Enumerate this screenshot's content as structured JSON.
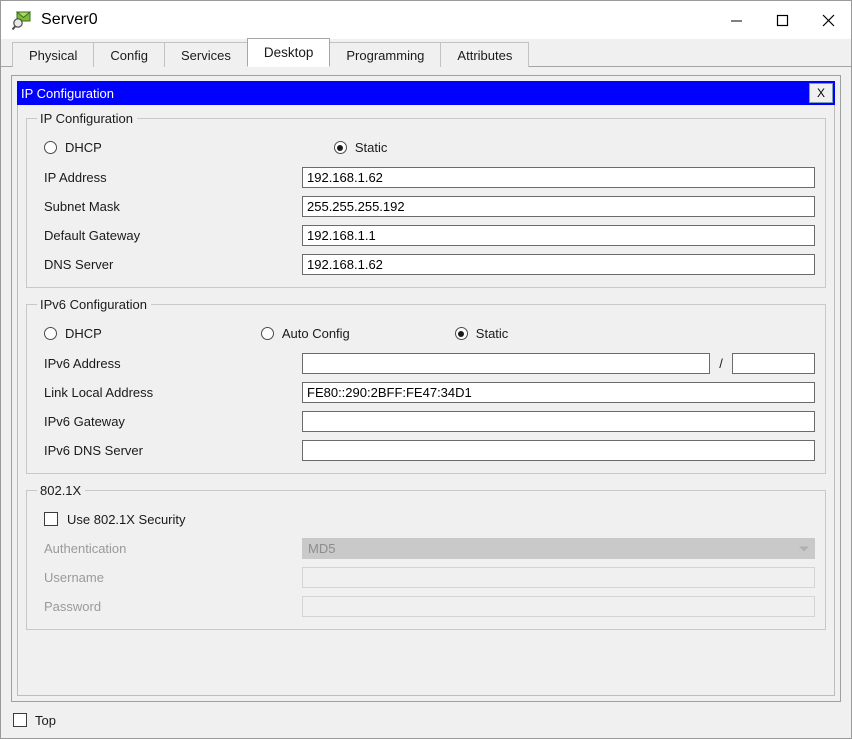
{
  "window": {
    "title": "Server0",
    "icon": "server-device-icon",
    "controls": {
      "minimize": "minimize-icon",
      "maximize": "maximize-icon",
      "close": "close-icon"
    }
  },
  "tabs": [
    {
      "label": "Physical",
      "active": false
    },
    {
      "label": "Config",
      "active": false
    },
    {
      "label": "Services",
      "active": false
    },
    {
      "label": "Desktop",
      "active": true
    },
    {
      "label": "Programming",
      "active": false
    },
    {
      "label": "Attributes",
      "active": false
    }
  ],
  "dialog": {
    "title": "IP Configuration",
    "close_label": "X",
    "header_color": "#0000ff",
    "header_text_color": "#ffffff"
  },
  "ipv4": {
    "legend": "IP Configuration",
    "mode_dhcp": {
      "label": "DHCP",
      "selected": false
    },
    "mode_static": {
      "label": "Static",
      "selected": true
    },
    "fields": [
      {
        "label": "IP Address",
        "value": "192.168.1.62"
      },
      {
        "label": "Subnet Mask",
        "value": "255.255.255.192"
      },
      {
        "label": "Default Gateway",
        "value": "192.168.1.1"
      },
      {
        "label": "DNS Server",
        "value": "192.168.1.62"
      }
    ]
  },
  "ipv6": {
    "legend": "IPv6 Configuration",
    "mode_dhcp": {
      "label": "DHCP",
      "selected": false
    },
    "mode_auto": {
      "label": "Auto Config",
      "selected": false
    },
    "mode_static": {
      "label": "Static",
      "selected": true
    },
    "address": {
      "label": "IPv6 Address",
      "value": "",
      "prefix_separator": "/",
      "prefix_value": ""
    },
    "link_local": {
      "label": "Link Local Address",
      "value": "FE80::290:2BFF:FE47:34D1"
    },
    "gateway": {
      "label": "IPv6 Gateway",
      "value": ""
    },
    "dns": {
      "label": "IPv6 DNS Server",
      "value": ""
    }
  },
  "dot1x": {
    "legend": "802.1X",
    "use_security": {
      "label": "Use 802.1X Security",
      "checked": false
    },
    "authentication": {
      "label": "Authentication",
      "value": "MD5",
      "disabled": true
    },
    "username": {
      "label": "Username",
      "value": "",
      "disabled": true
    },
    "password": {
      "label": "Password",
      "value": "",
      "disabled": true
    }
  },
  "bottom": {
    "top_checkbox": {
      "label": "Top",
      "checked": false
    }
  }
}
